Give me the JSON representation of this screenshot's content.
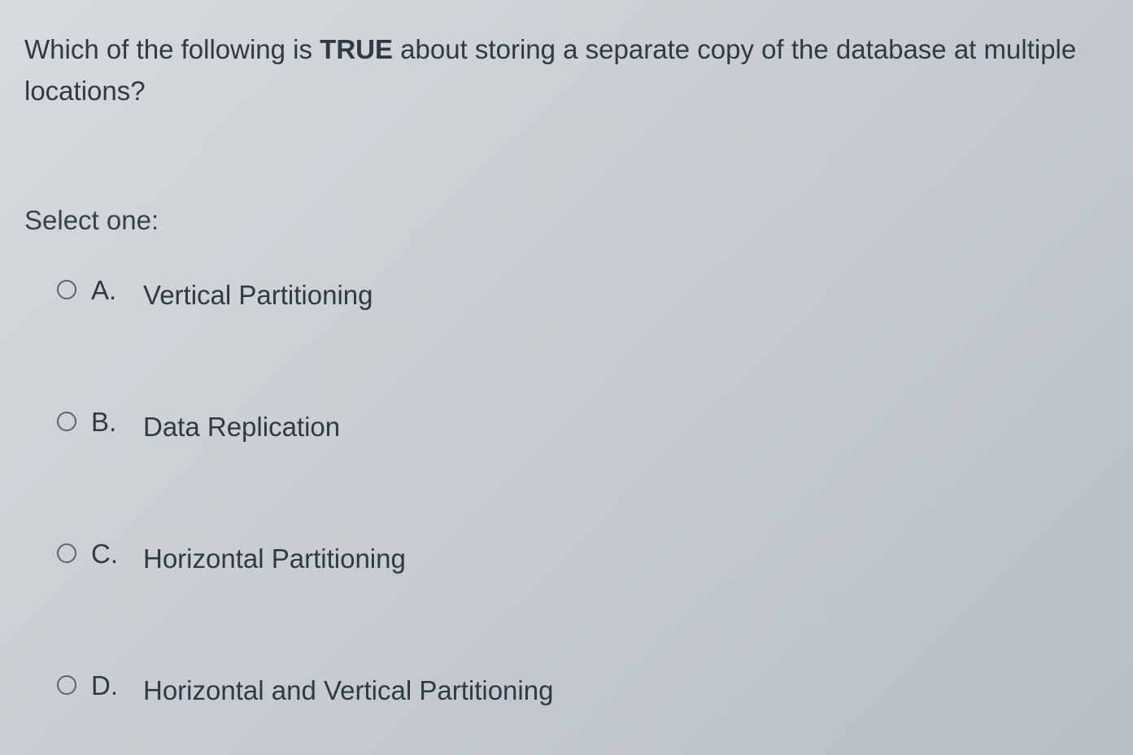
{
  "question": {
    "prefix": "Which of the following is ",
    "bold": "TRUE",
    "suffix": " about storing a separate copy of the database at multiple locations?"
  },
  "select_label": "Select one:",
  "options": [
    {
      "letter": "A.",
      "text": "Vertical Partitioning"
    },
    {
      "letter": "B.",
      "text": "Data Replication"
    },
    {
      "letter": "C.",
      "text": "Horizontal Partitioning"
    },
    {
      "letter": "D.",
      "text": "Horizontal and Vertical Partitioning"
    }
  ]
}
